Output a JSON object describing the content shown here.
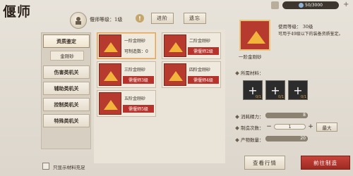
{
  "header": {
    "title": "偃师",
    "currency": "50/3000",
    "currency_add": "+"
  },
  "level": {
    "text": "偃师等级：1级",
    "info_icon": "!"
  },
  "top_buttons": {
    "advance": "进阶",
    "forget": "遗忘"
  },
  "sidebar": {
    "categories": [
      {
        "label": "资质鉴定",
        "active": true
      },
      {
        "label": "伤害类机关"
      },
      {
        "label": "辅助类机关"
      },
      {
        "label": "控制类机关"
      },
      {
        "label": "特殊类机关"
      }
    ],
    "subcategory": "金刚砂"
  },
  "items": [
    {
      "name": "一阶金刚砂",
      "sub": "可制造数：0",
      "badge": ""
    },
    {
      "name": "二阶金刚砂",
      "sub": "",
      "badge": "需偃师2级"
    },
    {
      "name": "三阶金刚砂",
      "sub": "",
      "badge": "需偃师3级"
    },
    {
      "name": "四阶金刚砂",
      "sub": "",
      "badge": "需偃师4级"
    },
    {
      "name": "五阶金刚砂",
      "sub": "",
      "badge": "需偃师5级"
    }
  ],
  "detail": {
    "item_name": "一阶金刚砂",
    "use_level": "使用等级：  30级",
    "description": "可用于49级以下的装备资质鉴定。",
    "materials_label": "所需材料：",
    "materials": [
      {
        "count": "0/1"
      },
      {
        "count": "0/1"
      },
      {
        "count": "0/1"
      }
    ],
    "energy_label": "消耗精力：",
    "energy_value": "8",
    "craft_count_label": "制造次数：",
    "craft_count_value": "1",
    "max_label": "最大",
    "output_label": "产物数量：",
    "output_value": "20"
  },
  "footer": {
    "only_show_label": "只显示材料充足",
    "market_button": "查看行情",
    "craft_button": "前往制造"
  }
}
